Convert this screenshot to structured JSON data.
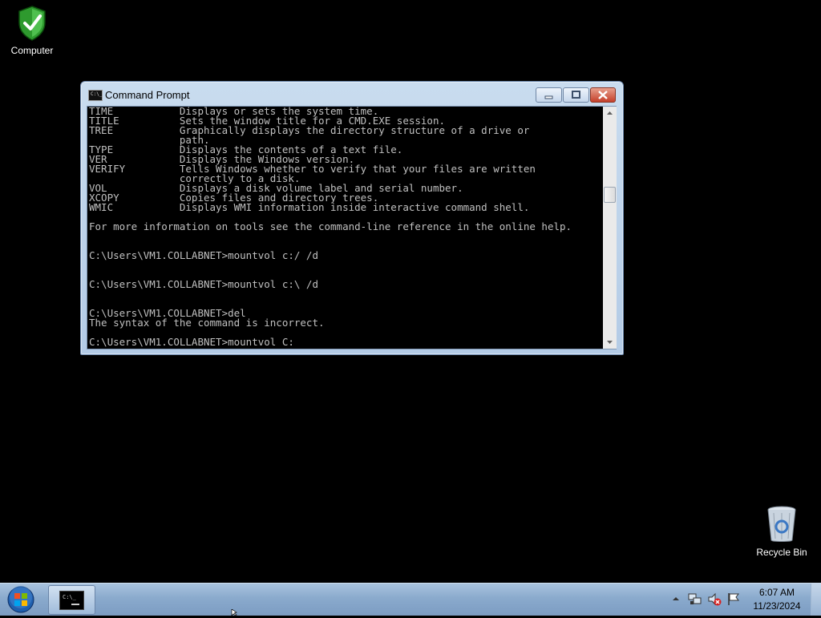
{
  "desktop": {
    "icons": [
      {
        "label": "Computer",
        "icon": "computer-shield-icon"
      },
      {
        "label": "Recycle Bin",
        "icon": "recycle-bin-icon"
      }
    ]
  },
  "window": {
    "title": "Command Prompt",
    "buttons": {
      "minimize": "minimize",
      "maximize": "maximize",
      "close": "close"
    },
    "console_lines": [
      "TIME           Displays or sets the system time.",
      "TITLE          Sets the window title for a CMD.EXE session.",
      "TREE           Graphically displays the directory structure of a drive or",
      "               path.",
      "TYPE           Displays the contents of a text file.",
      "VER            Displays the Windows version.",
      "VERIFY         Tells Windows whether to verify that your files are written",
      "               correctly to a disk.",
      "VOL            Displays a disk volume label and serial number.",
      "XCOPY          Copies files and directory trees.",
      "WMIC           Displays WMI information inside interactive command shell.",
      "",
      "For more information on tools see the command-line reference in the online help.",
      "",
      "",
      "C:\\Users\\VM1.COLLABNET>mountvol c:/ /d",
      "",
      "",
      "C:\\Users\\VM1.COLLABNET>mountvol c:\\ /d",
      "",
      "",
      "C:\\Users\\VM1.COLLABNET>del",
      "The syntax of the command is incorrect.",
      "",
      "C:\\Users\\VM1.COLLABNET>mountvol C:"
    ]
  },
  "taskbar": {
    "clock_time": "6:07 AM",
    "clock_date": "11/23/2024",
    "tray_icons": [
      "show-hidden-icons-icon",
      "network-icon",
      "volume-muted-icon",
      "action-center-flag-icon"
    ],
    "task_buttons": [
      "command-prompt-taskbar-icon"
    ]
  },
  "colors": {
    "console_bg": "#000000",
    "console_fg": "#c0c0c0",
    "desktop_bg": "#000000"
  }
}
